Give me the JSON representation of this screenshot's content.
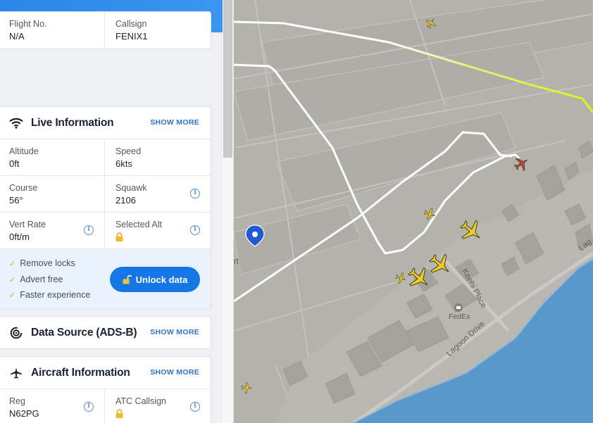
{
  "flight_card": {
    "flight_no_label": "Flight No.",
    "flight_no_value": "N/A",
    "callsign_label": "Callsign",
    "callsign_value": "FENIX1"
  },
  "live_info": {
    "title": "Live Information",
    "show_more": "SHOW MORE",
    "altitude_label": "Altitude",
    "altitude_value": "0ft",
    "speed_label": "Speed",
    "speed_value": "6kts",
    "course_label": "Course",
    "course_value": "56°",
    "squawk_label": "Squawk",
    "squawk_value": "2106",
    "vert_rate_label": "Vert Rate",
    "vert_rate_value": "0ft/m",
    "selected_alt_label": "Selected Alt"
  },
  "promo": {
    "benefits": [
      "Remove locks",
      "Advert free",
      "Faster experience"
    ],
    "unlock_label": "Unlock data"
  },
  "data_source": {
    "title": "Data Source (ADS-B)",
    "show_more": "SHOW MORE"
  },
  "aircraft_info": {
    "title": "Aircraft Information",
    "show_more": "SHOW MORE",
    "reg_label": "Reg",
    "reg_value": "N62PG",
    "atc_callsign_label": "ATC Callsign"
  },
  "map": {
    "street_labels": [
      "Keehi Place",
      "Lagoon Drive",
      "Lag"
    ],
    "poi_fedex": "FedEx",
    "partial_label": "rt"
  },
  "colors": {
    "accent": "#1577e6",
    "selected_aircraft": "#c0442c",
    "aircraft": "#f2cc1e",
    "flight_path": "#ffffff",
    "trail_highlight": "#d8f51f",
    "water": "#5a98cc",
    "marker": "#2158d6"
  }
}
